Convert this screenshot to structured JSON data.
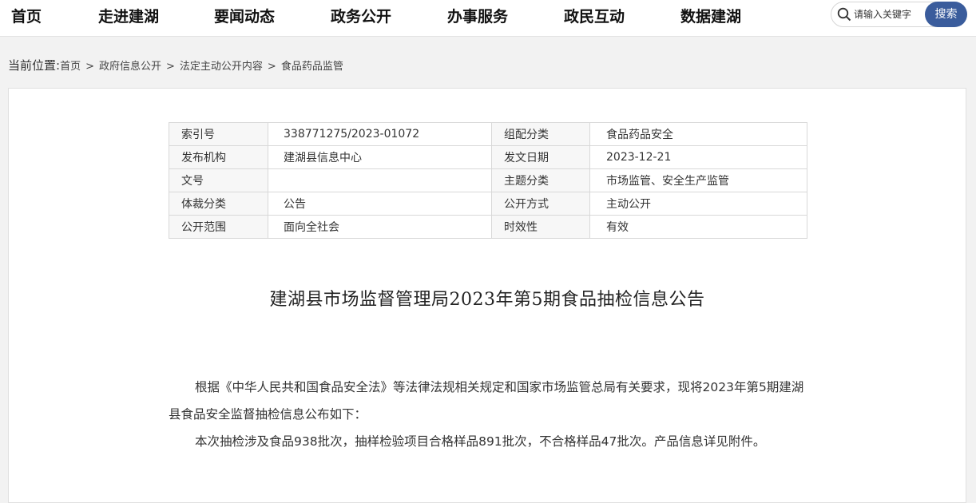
{
  "nav": {
    "items": [
      "首页",
      "走进建湖",
      "要闻动态",
      "政务公开",
      "办事服务",
      "政民互动",
      "数据建湖"
    ]
  },
  "search": {
    "placeholder": "请输入关键字",
    "button_label": "搜索"
  },
  "breadcrumb": {
    "label": "当前位置:",
    "items": [
      "首页",
      "政府信息公开",
      "法定主动公开内容",
      "食品药品监管"
    ],
    "separator": ">"
  },
  "meta_table": {
    "rows": [
      {
        "k1": "索引号",
        "v1": "338771275/2023-01072",
        "k2": "组配分类",
        "v2": "食品药品安全"
      },
      {
        "k1": "发布机构",
        "v1": "建湖县信息中心",
        "k2": "发文日期",
        "v2": "2023-12-21"
      },
      {
        "k1": "文号",
        "v1": "",
        "k2": "主题分类",
        "v2": "市场监管、安全生产监管"
      },
      {
        "k1": "体裁分类",
        "v1": "公告",
        "k2": "公开方式",
        "v2": "主动公开"
      },
      {
        "k1": "公开范围",
        "v1": "面向全社会",
        "k2": "时效性",
        "v2": "有效"
      }
    ]
  },
  "article": {
    "title": "建湖县市场监督管理局2023年第5期食品抽检信息公告",
    "paragraphs": [
      "根据《中华人民共和国食品安全法》等法律法规相关规定和国家市场监管总局有关要求，现将2023年第5期建湖县食品安全监督抽检信息公布如下：",
      "本次抽检涉及食品938批次，抽样检验项目合格样品891批次，不合格样品47批次。产品信息详见附件。"
    ]
  },
  "colors": {
    "search_button": "#3a5c9c",
    "page_background": "#f2f2f2"
  }
}
